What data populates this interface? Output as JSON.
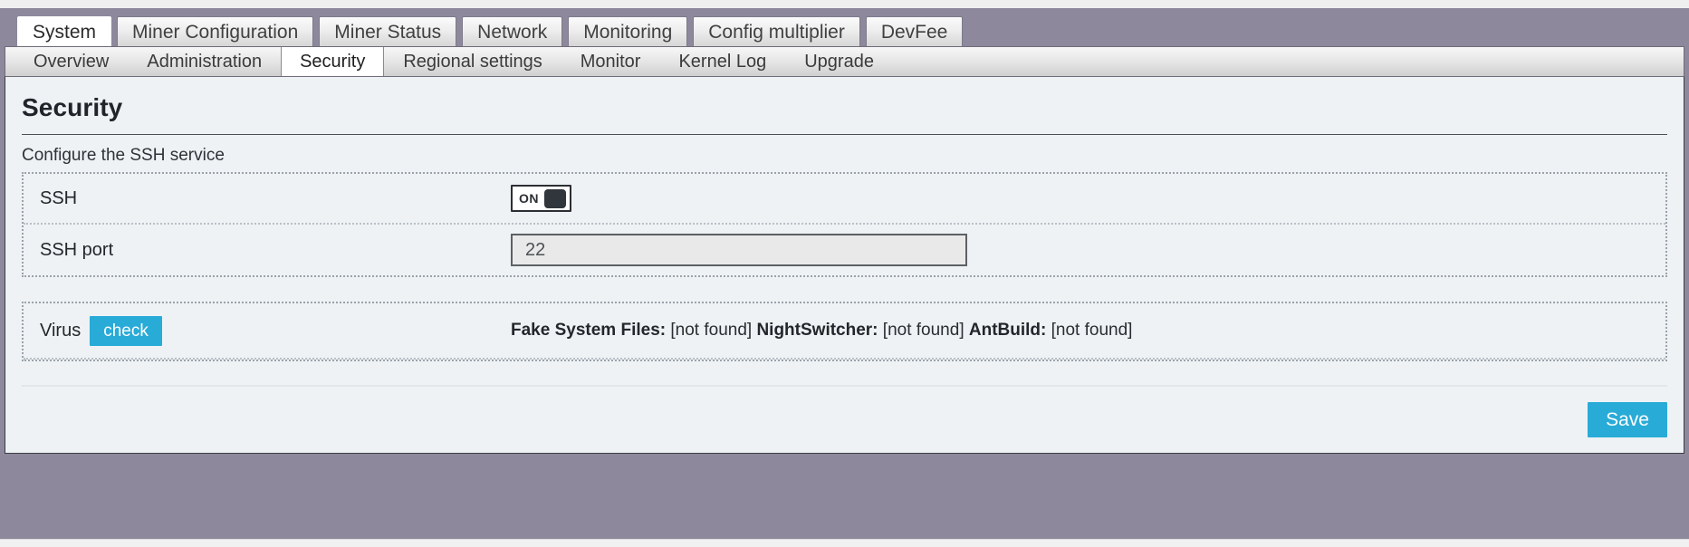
{
  "window": {
    "frame_color": "#8d889c",
    "panel_bg": "#eef2f4",
    "accent_color": "#29abd8"
  },
  "main_tabs": [
    {
      "label": "System",
      "active": true
    },
    {
      "label": "Miner Configuration",
      "active": false
    },
    {
      "label": "Miner Status",
      "active": false
    },
    {
      "label": "Network",
      "active": false
    },
    {
      "label": "Monitoring",
      "active": false
    },
    {
      "label": "Config multiplier",
      "active": false
    },
    {
      "label": "DevFee",
      "active": false
    }
  ],
  "sub_tabs": [
    {
      "label": "Overview",
      "active": false
    },
    {
      "label": "Administration",
      "active": false
    },
    {
      "label": "Security",
      "active": true
    },
    {
      "label": "Regional settings",
      "active": false
    },
    {
      "label": "Monitor",
      "active": false
    },
    {
      "label": "Kernel Log",
      "active": false
    },
    {
      "label": "Upgrade",
      "active": false
    }
  ],
  "page": {
    "title": "Security",
    "legend": "Configure the SSH service"
  },
  "ssh": {
    "label": "SSH",
    "toggle_state": "ON",
    "port_label": "SSH port",
    "port_value": "22",
    "port_placeholder": "22"
  },
  "virus": {
    "label": "Virus",
    "check_button": "check",
    "results": [
      {
        "name": "Fake System Files:",
        "value": "[not found]"
      },
      {
        "name": "NightSwitcher:",
        "value": "[not found]"
      },
      {
        "name": "AntBuild:",
        "value": "[not found]"
      }
    ]
  },
  "footer": {
    "save_label": "Save"
  }
}
